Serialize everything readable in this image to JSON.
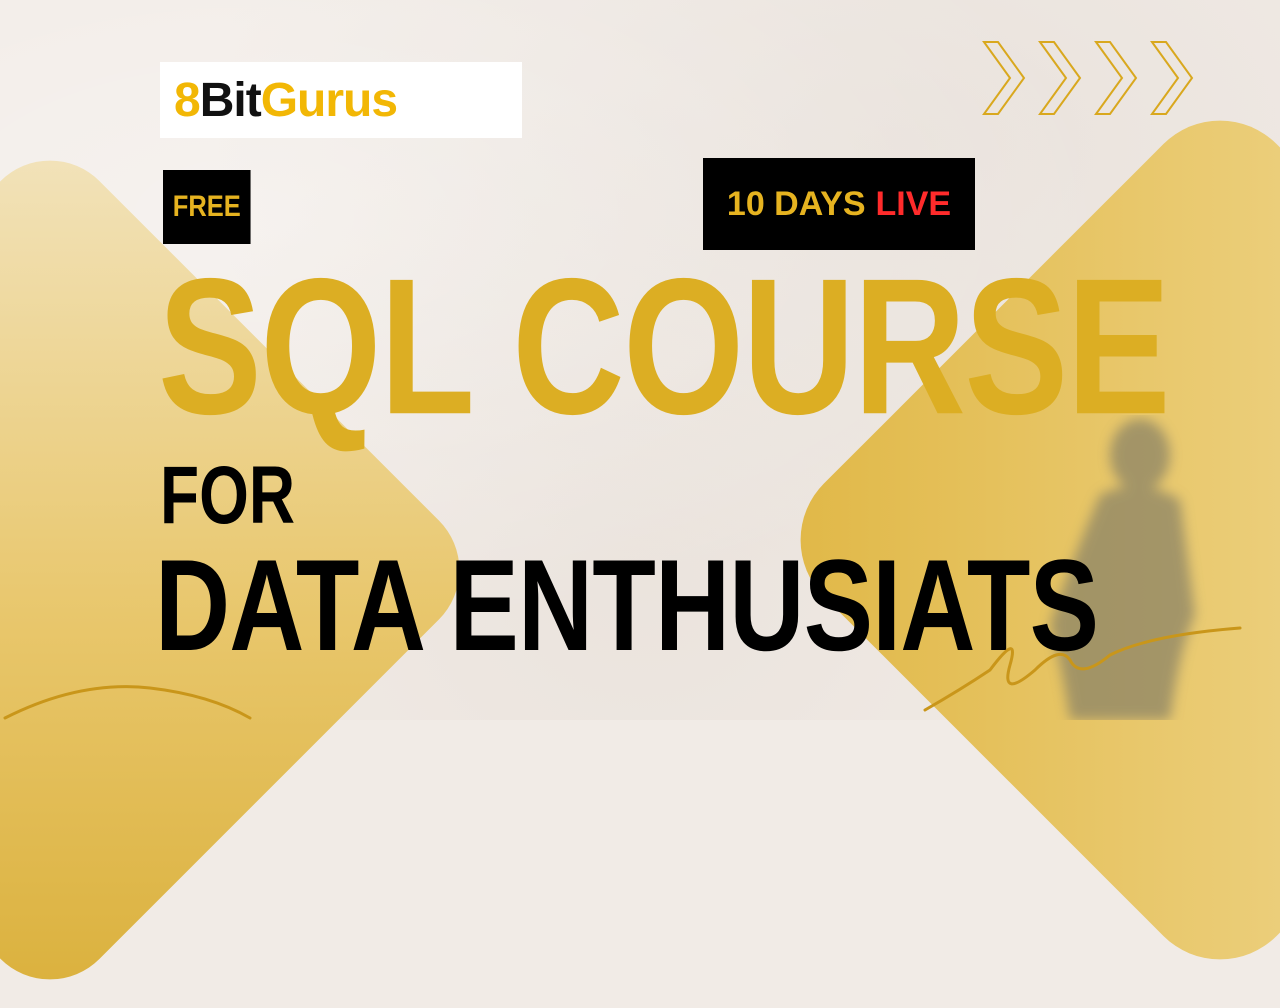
{
  "logo": {
    "part1": "8",
    "part2": "Bit",
    "part3": "Gurus"
  },
  "badges": {
    "free": "FREE",
    "days": "10 DAYS",
    "live": "LIVE"
  },
  "headline": {
    "main": "SQL COURSE",
    "connector": "FOR",
    "subject": "DATA ENTHUSIATS"
  },
  "colors": {
    "accent": "#dcae23",
    "logo_yellow": "#f2b705",
    "live_red": "#ff2b2b",
    "background": "#f1ebe6"
  },
  "icons": [
    "chevrons-right-icon",
    "squiggle-decoration",
    "person-shadow"
  ]
}
